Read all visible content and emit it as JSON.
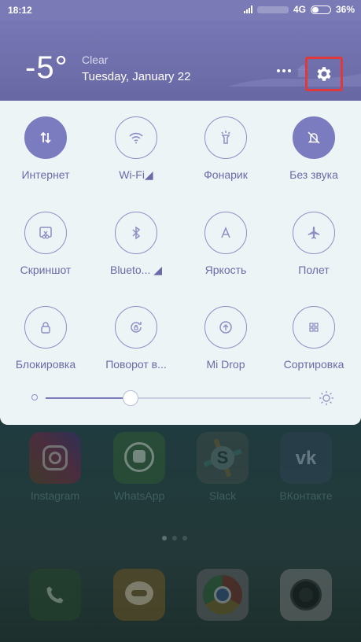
{
  "status_bar": {
    "time": "18:12",
    "network": "4G",
    "battery": "36%",
    "battery_level": 0.36
  },
  "weather": {
    "temperature": "-5°",
    "condition": "Clear",
    "date": "Tuesday, January 22"
  },
  "header_icons": {
    "more": "more-dots-icon",
    "settings": "gear-icon"
  },
  "quick_toggles": [
    {
      "label": "Интернет",
      "icon": "mobile-data-icon",
      "active": true
    },
    {
      "label": "Wi-Fi◢",
      "icon": "wifi-icon",
      "active": false
    },
    {
      "label": "Фонарик",
      "icon": "flashlight-icon",
      "active": false
    },
    {
      "label": "Без звука",
      "icon": "bell-off-icon",
      "active": true
    },
    {
      "label": "Скриншот",
      "icon": "screenshot-scissors-icon",
      "active": false
    },
    {
      "label": "Blueto... ◢",
      "icon": "bluetooth-icon",
      "active": false
    },
    {
      "label": "Яркость",
      "icon": "brightness-a-icon",
      "active": false
    },
    {
      "label": "Полет",
      "icon": "airplane-icon",
      "active": false
    },
    {
      "label": "Блокировка",
      "icon": "lock-icon",
      "active": false
    },
    {
      "label": "Поворот в...",
      "icon": "rotation-lock-icon",
      "active": false
    },
    {
      "label": "Mi Drop",
      "icon": "mi-drop-icon",
      "active": false
    },
    {
      "label": "Сортировка",
      "icon": "sort-grid-icon",
      "active": false
    }
  ],
  "brightness": {
    "level": 0.32
  },
  "home_apps": [
    {
      "name": "Instagram",
      "icon": "instagram-icon"
    },
    {
      "name": "WhatsApp",
      "icon": "whatsapp-icon"
    },
    {
      "name": "Slack",
      "icon": "slack-icon"
    },
    {
      "name": "ВКонтакте",
      "icon": "vk-icon"
    }
  ],
  "dock_apps": [
    {
      "icon": "phone-icon"
    },
    {
      "icon": "messaging-icon"
    },
    {
      "icon": "chrome-icon"
    },
    {
      "icon": "camera-icon"
    }
  ],
  "colors": {
    "accent": "#7b7bc0",
    "header": "#7474b2",
    "panel": "#edf4f5",
    "highlight": "#e0393b"
  }
}
